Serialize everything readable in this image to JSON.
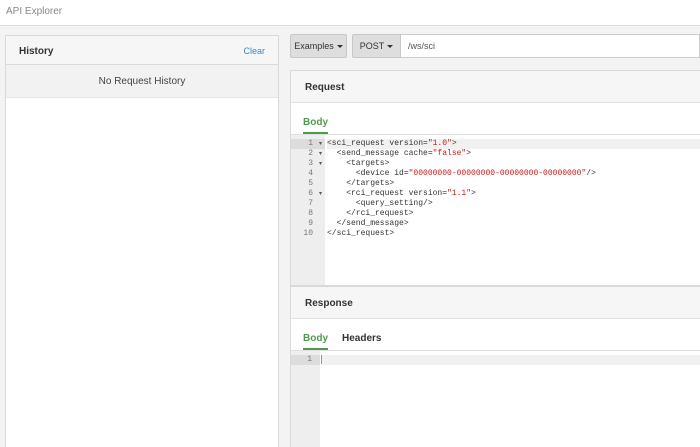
{
  "app": {
    "title": "API Explorer"
  },
  "history": {
    "title": "History",
    "clear_label": "Clear",
    "empty_text": "No Request History"
  },
  "toolbar": {
    "examples_label": "Examples",
    "method_label": "POST",
    "url_value": "/ws/sci"
  },
  "request": {
    "title": "Request",
    "tabs": [
      {
        "label": "Body",
        "active": true
      }
    ],
    "code_lines": [
      "<sci_request version=\"1.0\">",
      "  <send_message cache=\"false\">",
      "    <targets>",
      "      <device id=\"00000000-00000000-00000000-00000000\"/>",
      "    </targets>",
      "    <rci_request version=\"1.1\">",
      "      <query_setting/>",
      "    </rci_request>",
      "  </send_message>",
      "</sci_request>"
    ],
    "line_numbers": [
      "1",
      "2",
      "3",
      "4",
      "5",
      "6",
      "7",
      "8",
      "9",
      "10"
    ],
    "fold_lines": [
      1,
      2,
      3,
      6
    ]
  },
  "response": {
    "title": "Response",
    "tabs": [
      {
        "label": "Body",
        "active": true
      },
      {
        "label": "Headers",
        "active": false
      }
    ],
    "line_numbers": [
      "1"
    ]
  },
  "colors": {
    "active_tab": "#4f9a4f",
    "link": "#3a87c9",
    "string": "#c41a16"
  }
}
